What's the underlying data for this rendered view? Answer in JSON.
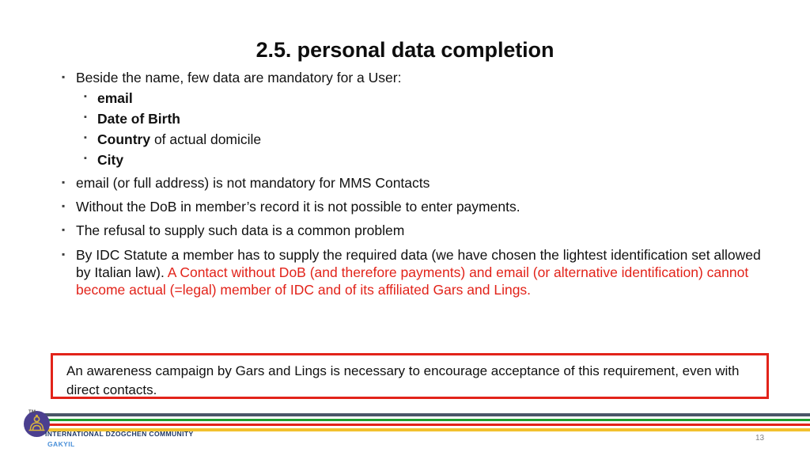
{
  "slide": {
    "title": "2.5. personal data completion",
    "page_number": "13",
    "accent_red": "#e2231a",
    "text_color": "#111111"
  },
  "content": {
    "bullets": [
      {
        "text": "Beside the name, few data are mandatory for a User:"
      },
      {
        "text": "email (or full address) is not mandatory for MMS Contacts"
      },
      {
        "text": "Without the DoB in member’s record  it is not possible to enter payments."
      },
      {
        "text": "The refusal to supply such data is a common problem"
      }
    ],
    "sub_bullets": [
      {
        "bold": "email",
        "rest": ""
      },
      {
        "bold": "Date of Birth",
        "rest": ""
      },
      {
        "bold": "Country",
        "rest": " of actual domicile"
      },
      {
        "bold": "City",
        "rest": ""
      }
    ],
    "statute_paragraph": {
      "black_part": "By IDC Statute a member has to supply the required data (we have chosen the lightest identification set allowed by Italian law).",
      "red_part": " A Contact without DoB (and therefore payments) and email (or alternative identification) cannot become actual (=legal) member of IDC and of its affiliated Gars and Lings."
    }
  },
  "callout": {
    "text": "An awareness campaign by Gars and Lings is necessary to encourage acceptance of this requirement, even with direct contacts.",
    "border_color": "#e2231a"
  },
  "footer": {
    "trademark": "TM",
    "organization": "INTERNATIONAL DZOGCHEN COMMUNITY",
    "department": "GAKYIL",
    "stripe_colors": [
      "#4a5568",
      "#1f9e2f",
      "#e2231a",
      "#f2c12e"
    ],
    "logo_color": "#4b3f8f",
    "logo_emblem_color": "#d9b43c"
  },
  "icons": {
    "bullet": "▪",
    "sub_bullet": "▪"
  }
}
